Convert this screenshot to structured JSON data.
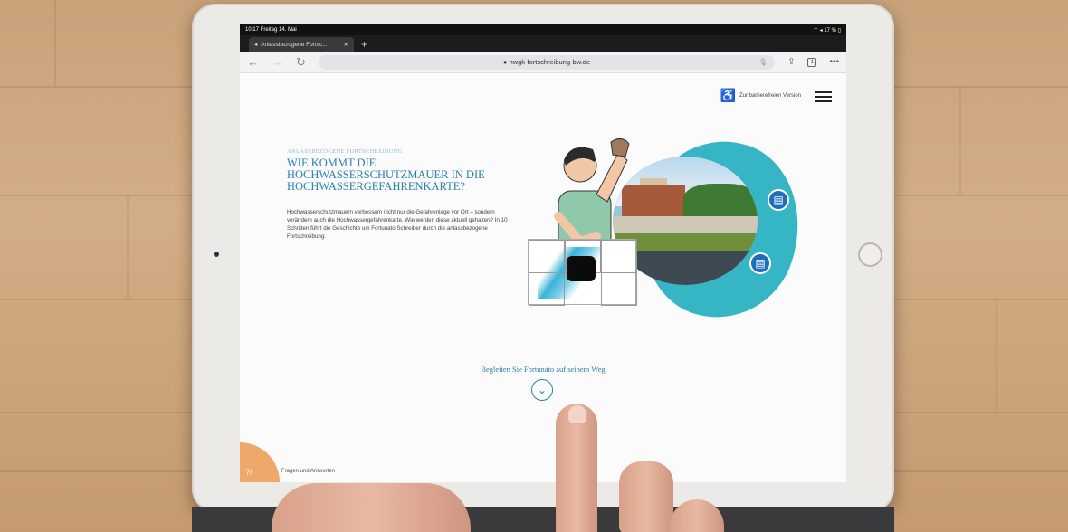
{
  "statusbar": {
    "time": "10:17  Freitag 14. Mai",
    "indicators": "⌔ ◂ 17 % ▯"
  },
  "browser": {
    "tab_title": "Anlassbezogene Fortsc...",
    "tab_close": "✕",
    "new_tab": "+",
    "url": "● hwgk-fortschreibung-bw.de",
    "tab_count": "1"
  },
  "page": {
    "accessibility_link": "Zur barrierefreien Version",
    "kicker": "ANLASSBEZOGENE FORTSCHREIBUNG",
    "headline": "WIE KOMMT DIE HOCHWASSERSCHUTZMAUER IN DIE HOCHWASSERGEFAHRENKARTE?",
    "lead": "Hochwasserschutzmauern verbessern nicht nur die Gefahrenlage vor Ort – sondern verändern auch die Hochwassergefahrenkarte. Wie werden diese aktuell gehalten? In 10 Schritten führt die Geschichte um Fortunato Schreiber durch die anlassbezogene Fortschreibung.",
    "cta": "Begleiten Sie Fortunato auf seinem Weg",
    "faq_label": "Fragen und Antworten"
  },
  "colors": {
    "accent": "#2a7fb0",
    "teal": "#36b6c4",
    "faq": "#eea86a"
  }
}
